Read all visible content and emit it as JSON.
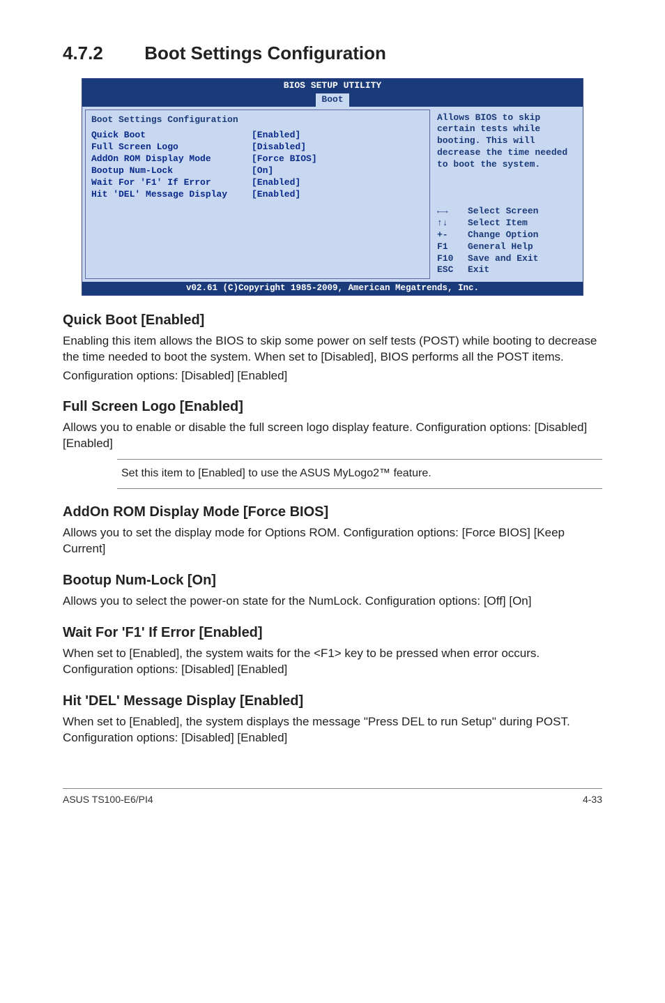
{
  "heading": {
    "num": "4.7.2",
    "title": "Boot Settings Configuration"
  },
  "bios": {
    "title": "BIOS SETUP UTILITY",
    "tab": "Boot",
    "section_title": "Boot Settings Configuration",
    "rows": [
      {
        "label": "Quick Boot",
        "value": "[Enabled]"
      },
      {
        "label": "Full Screen Logo",
        "value": "[Disabled]"
      },
      {
        "label": "AddOn ROM Display Mode",
        "value": "[Force BIOS]"
      },
      {
        "label": "Bootup Num-Lock",
        "value": "[On]"
      },
      {
        "label": "Wait For 'F1' If Error",
        "value": "[Enabled]"
      },
      {
        "label": "Hit 'DEL' Message Display",
        "value": "[Enabled]"
      }
    ],
    "help_text": "Allows BIOS to skip certain tests while booting. This will decrease the time needed to boot the system.",
    "nav": [
      {
        "keys": "←→",
        "desc": "Select Screen"
      },
      {
        "keys": "↑↓",
        "desc": "Select Item"
      },
      {
        "keys": "+-",
        "desc": "Change Option"
      },
      {
        "keys": "F1",
        "desc": "General Help"
      },
      {
        "keys": "F10",
        "desc": "Save and Exit"
      },
      {
        "keys": "ESC",
        "desc": "Exit"
      }
    ],
    "footer": "v02.61 (C)Copyright 1985-2009, American Megatrends, Inc."
  },
  "sections": {
    "quick_boot": {
      "title": "Quick Boot [Enabled]",
      "p1": "Enabling this item allows the BIOS to skip some power on self tests (POST) while booting to decrease the time needed to boot the system. When set to [Disabled], BIOS performs all the POST items.",
      "p2": "Configuration options: [Disabled] [Enabled]"
    },
    "full_screen_logo": {
      "title": "Full Screen Logo [Enabled]",
      "p1": "Allows you to enable or disable the full screen logo display feature. Configuration options: [Disabled] [Enabled]"
    },
    "note": "Set this item to [Enabled] to use the ASUS MyLogo2™ feature.",
    "addon_rom": {
      "title": "AddOn ROM Display Mode [Force BIOS]",
      "p1": "Allows you to set the display mode for Options ROM. Configuration options: [Force BIOS] [Keep Current]"
    },
    "numlock": {
      "title": "Bootup Num-Lock [On]",
      "p1": "Allows you to select the power-on state for the NumLock. Configuration options: [Off] [On]"
    },
    "wait_f1": {
      "title": "Wait For 'F1' If Error [Enabled]",
      "p1": "When set to [Enabled], the system waits for the <F1> key to be pressed when error occurs. Configuration options: [Disabled] [Enabled]"
    },
    "hit_del": {
      "title": "Hit 'DEL' Message Display [Enabled]",
      "p1": "When set to [Enabled], the system displays the message \"Press DEL to run Setup\" during POST. Configuration options: [Disabled] [Enabled]"
    }
  },
  "footer": {
    "left": "ASUS TS100-E6/PI4",
    "right": "4-33"
  }
}
